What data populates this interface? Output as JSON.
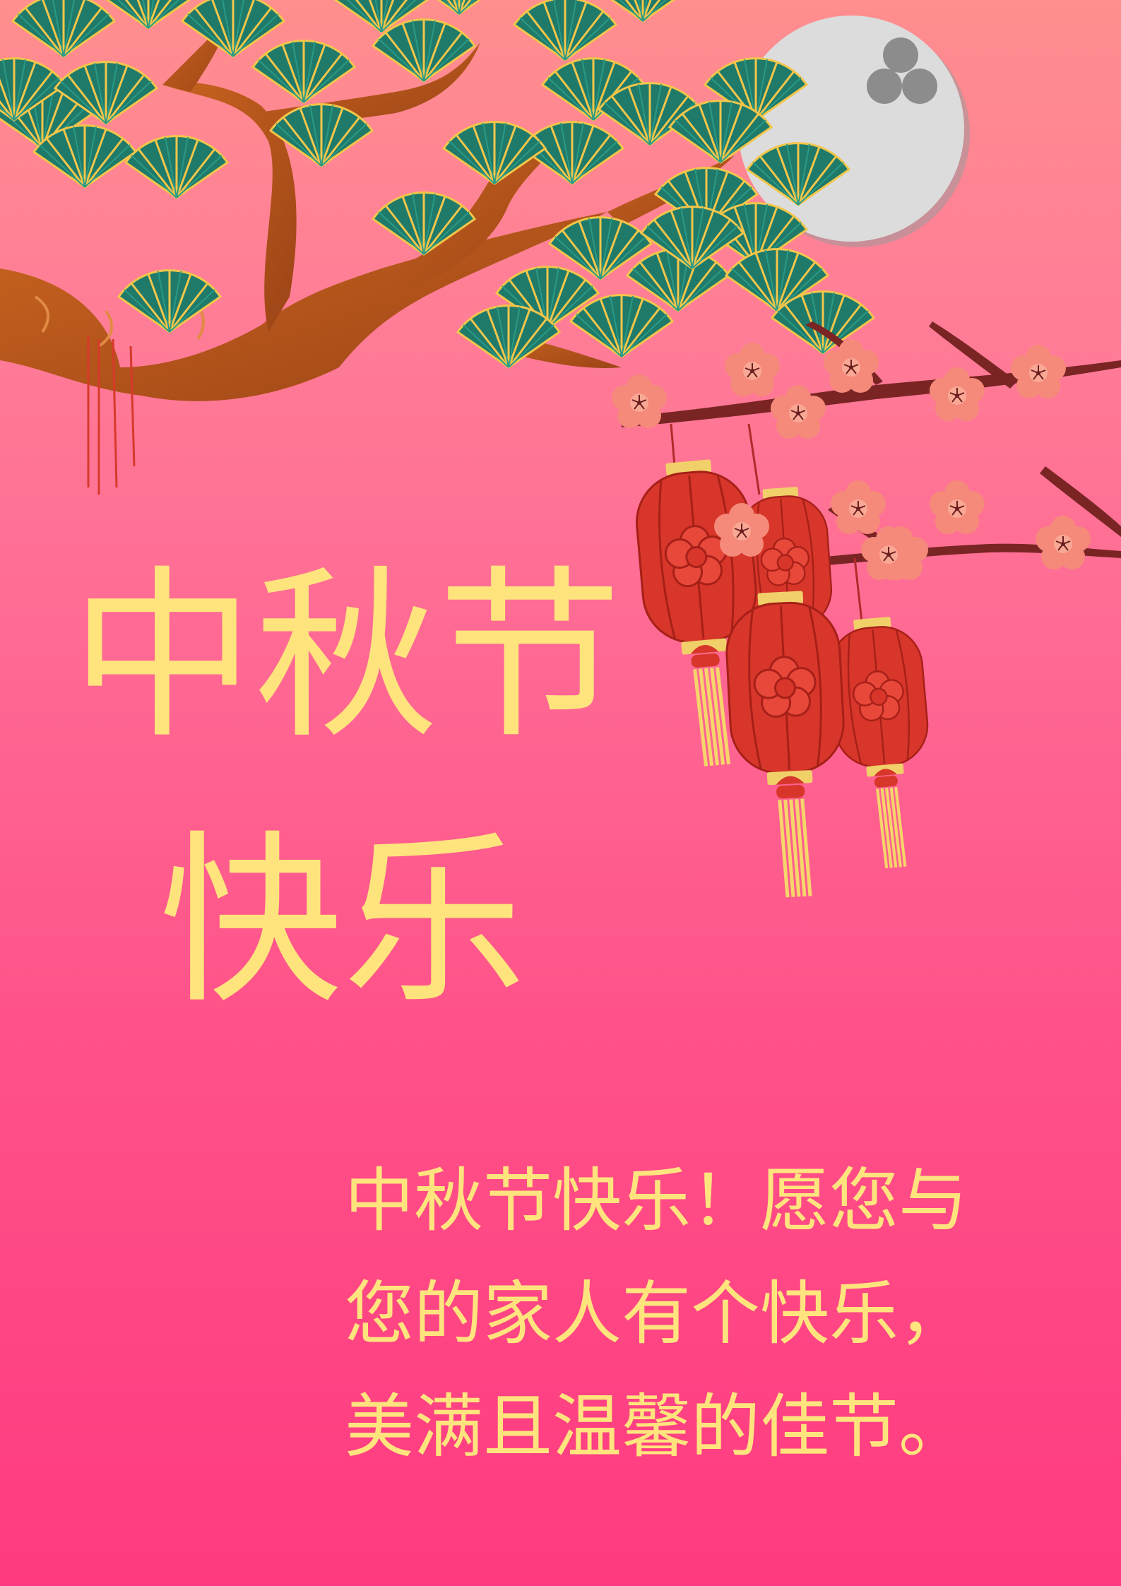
{
  "card": {
    "title_line1": "中秋节",
    "title_line2": "快乐",
    "greeting_lines": [
      "中秋节快乐！愿您与",
      "您的家人有个快乐，",
      "美满且温馨的佳节。"
    ]
  },
  "colors": {
    "background_top": "#ff8e8e",
    "background_bottom": "#ff3a80",
    "text": "#ffe47e",
    "branch": "#b8541f",
    "pine_needles": "#1f7a6a",
    "pine_tips": "#f3c64a",
    "moon": "#dcdcdc",
    "lantern": "#d8362a",
    "blossom": "#f58a7a",
    "tassel": "#f6d56b"
  },
  "icons": [
    "pine-tree-branch",
    "full-moon",
    "plum-blossom-branch",
    "red-lantern",
    "plum-blossom"
  ]
}
